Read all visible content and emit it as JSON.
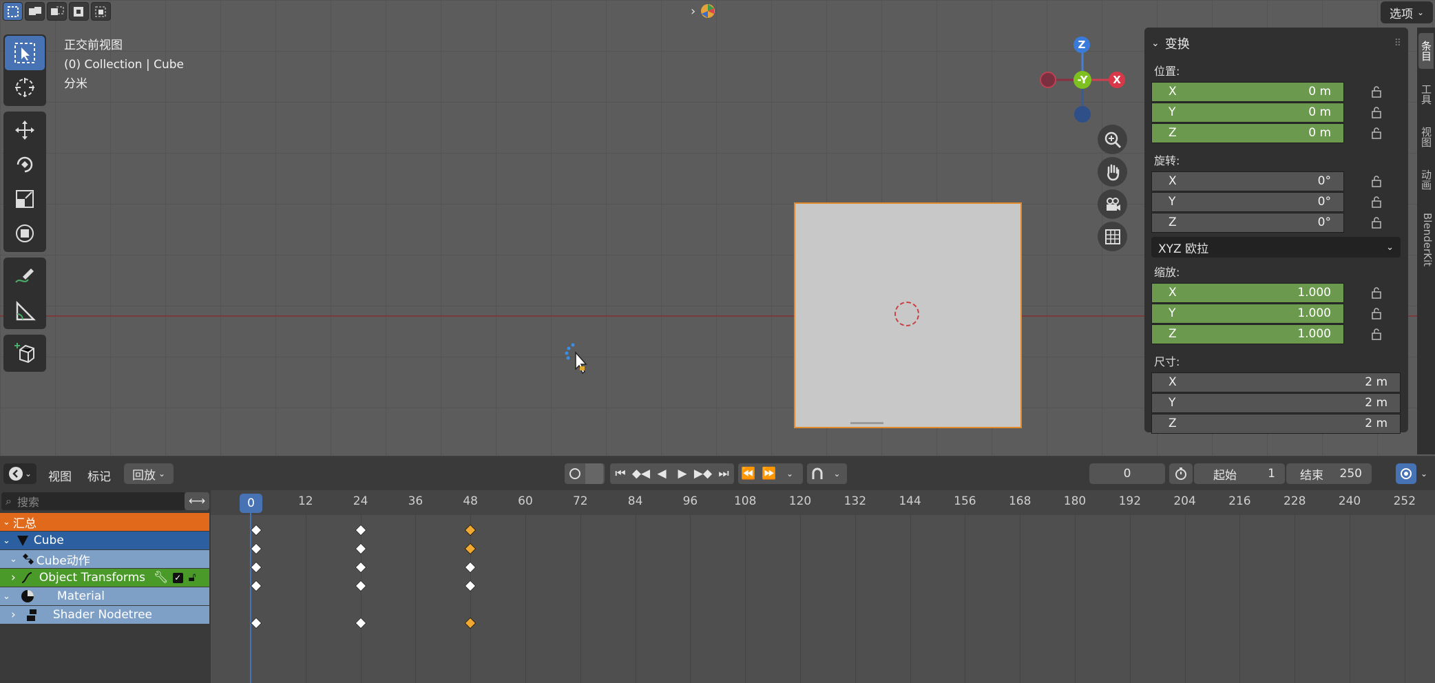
{
  "viewport": {
    "info_view": "正交前视图",
    "info_collection": "(0) Collection | Cube",
    "info_units": "分米",
    "options_label": "选项",
    "gizmo": {
      "z": "Z",
      "y": "-Y",
      "x": "X"
    }
  },
  "npanel": {
    "title": "变换",
    "location_label": "位置:",
    "location": [
      {
        "axis": "X",
        "value": "0 m"
      },
      {
        "axis": "Y",
        "value": "0 m"
      },
      {
        "axis": "Z",
        "value": "0 m"
      }
    ],
    "rotation_label": "旋转:",
    "rotation": [
      {
        "axis": "X",
        "value": "0°"
      },
      {
        "axis": "Y",
        "value": "0°"
      },
      {
        "axis": "Z",
        "value": "0°"
      }
    ],
    "rotation_mode": "XYZ 欧拉",
    "scale_label": "缩放:",
    "scale": [
      {
        "axis": "X",
        "value": "1.000"
      },
      {
        "axis": "Y",
        "value": "1.000"
      },
      {
        "axis": "Z",
        "value": "1.000"
      }
    ],
    "dimensions_label": "尺寸:",
    "dimensions": [
      {
        "axis": "X",
        "value": "2 m"
      },
      {
        "axis": "Y",
        "value": "2 m"
      },
      {
        "axis": "Z",
        "value": "2 m"
      }
    ],
    "tabs": [
      "条目",
      "工具",
      "视图",
      "动画",
      "BlenderKit"
    ]
  },
  "timeline": {
    "menu_view": "视图",
    "menu_marker": "标记",
    "menu_playback": "回放",
    "current_frame": "0",
    "start_label": "起始",
    "start_value": "1",
    "end_label": "结束",
    "end_value": "250",
    "search_placeholder": "搜索",
    "ruler": [
      "0",
      "12",
      "24",
      "36",
      "48",
      "60",
      "72",
      "84",
      "96",
      "108",
      "120",
      "132",
      "144",
      "156",
      "168",
      "180",
      "192",
      "204",
      "216",
      "228",
      "240",
      "252"
    ],
    "channels": {
      "summary": "汇总",
      "cube": "Cube",
      "action": "Cube动作",
      "group": "Object Transforms",
      "material": "Material",
      "nodetree": "Shader Nodetree"
    }
  },
  "colors": {
    "accent": "#4772b3",
    "summary": "#e0691b",
    "selected_obj": "#e08a2c",
    "keyframe_selected": "#f0a830"
  }
}
